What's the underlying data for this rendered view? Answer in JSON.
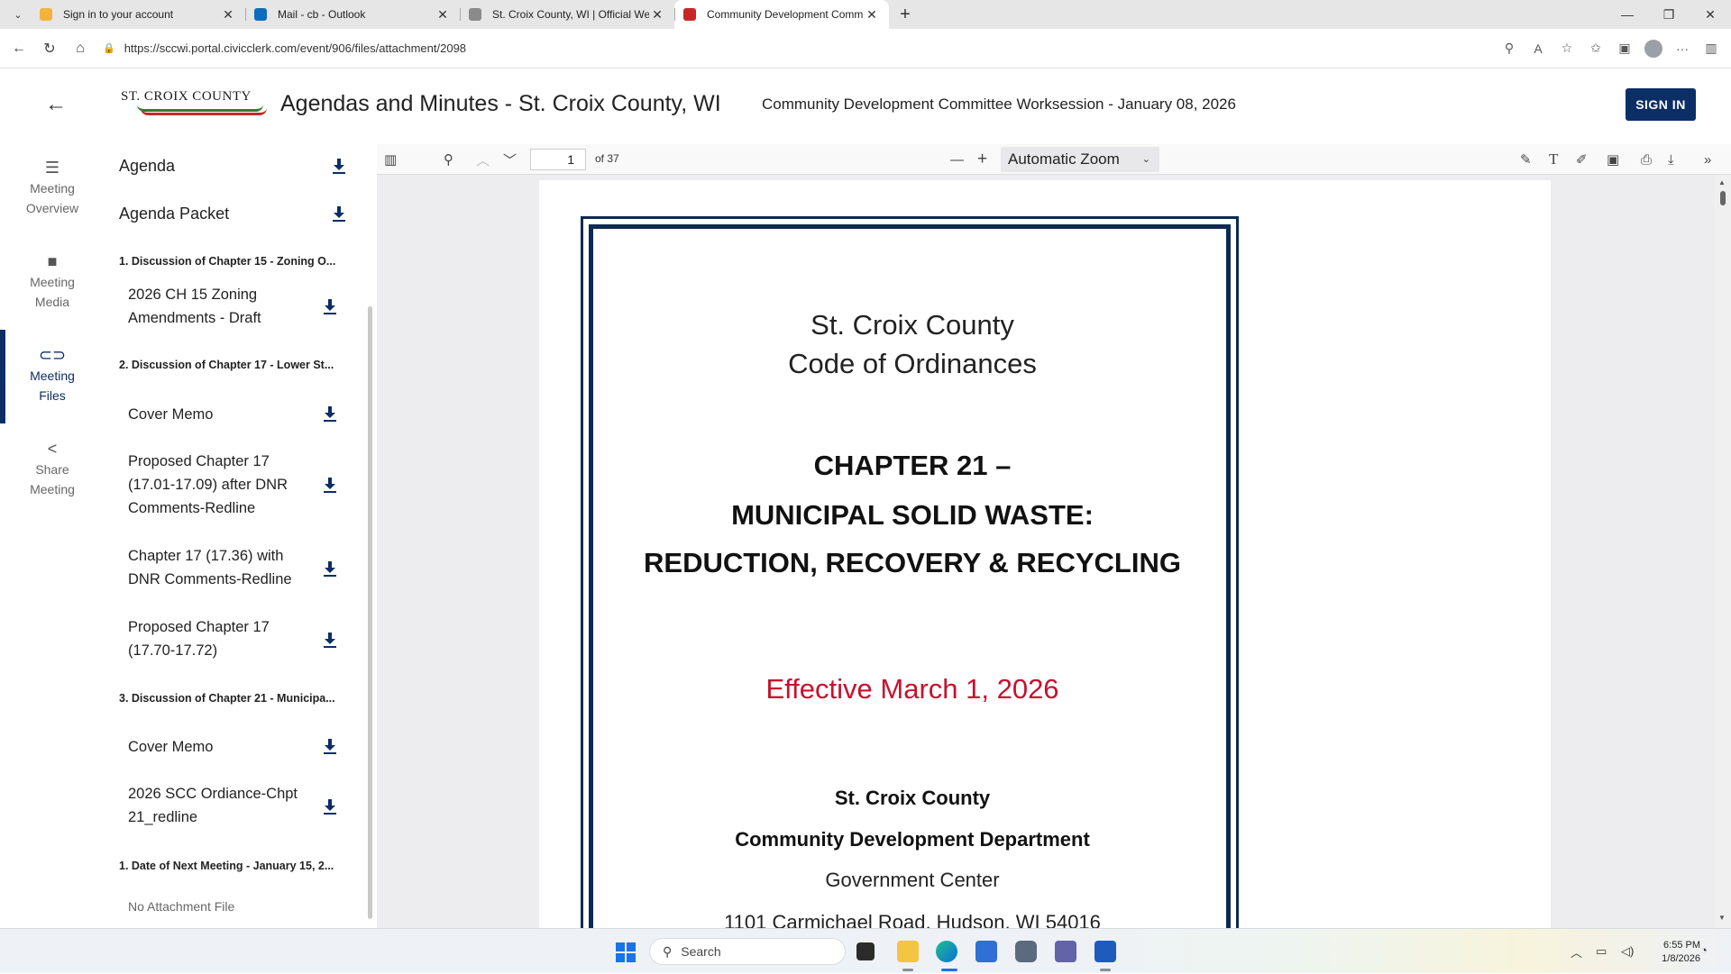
{
  "browser": {
    "tabs": [
      {
        "title": "Sign in to your account",
        "favicon_color": "#f3b33d",
        "active": false
      },
      {
        "title": "Mail - cb - Outlook",
        "favicon_color": "#0f6cbd",
        "active": false
      },
      {
        "title": "St. Croix County, WI | Official Web",
        "favicon_color": "#8a8a8a",
        "active": false
      },
      {
        "title": "Community Development Comm",
        "favicon_color": "#c62828",
        "active": true
      }
    ],
    "url": "https://sccwi.portal.civicclerk.com/event/906/files/attachment/2098"
  },
  "header": {
    "logo_text": "ST. CROIX COUNTY",
    "site_title": "Agendas and Minutes - St. Croix County, WI",
    "event_title": "Community Development Committee Worksession - January 08, 2026",
    "sign_in_label": "SIGN IN"
  },
  "rail": {
    "items": [
      {
        "label1": "Meeting",
        "label2": "Overview"
      },
      {
        "label1": "Meeting",
        "label2": "Media"
      },
      {
        "label1": "Meeting",
        "label2": "Files"
      },
      {
        "label1": "Share",
        "label2": "Meeting"
      }
    ]
  },
  "files": {
    "agenda": "Agenda",
    "agenda_packet": "Agenda Packet",
    "sections": [
      "1. Discussion of Chapter 15 - Zoning O...",
      "2. Discussion of Chapter 17 - Lower St...",
      "3. Discussion of Chapter 21 - Municipa...",
      "1. Date of Next Meeting - January 15, 2..."
    ],
    "items": [
      "2026 CH 15 Zoning Amendments - Draft",
      "Cover Memo",
      "Proposed Chapter 17 (17.01-17.09) after DNR Comments-Redline",
      "Chapter 17 (17.36) with DNR Comments-Redline",
      "Proposed Chapter 17 (17.70-17.72)",
      "Cover Memo",
      "2026 SCC Ordiance-Chpt 21_redline"
    ],
    "no_attachment": "No Attachment File"
  },
  "viewer": {
    "page_number": "1",
    "page_count_label": "of 37",
    "zoom": "Automatic Zoom"
  },
  "document": {
    "county": "St. Croix County",
    "code": "Code of Ordinances",
    "chapter": "CHAPTER 21 –",
    "title1": "MUNICIPAL SOLID WASTE:",
    "title2": "REDUCTION, RECOVERY & RECYCLING",
    "effective": "Effective March 1, 2026",
    "county2": "St. Croix County",
    "department": "Community Development Department",
    "building": "Government Center",
    "address": "1101 Carmichael Road, Hudson, WI 54016"
  },
  "taskbar": {
    "search_label": "Search",
    "time": "6:55 PM",
    "date": "1/8/2026"
  }
}
